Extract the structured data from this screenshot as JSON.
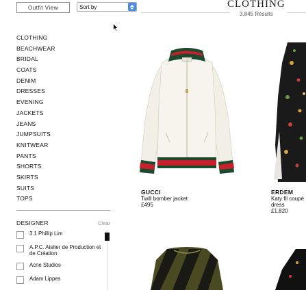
{
  "toolbar": {
    "outfit_view_label": "Outfit View",
    "sort_label": "Sort by"
  },
  "header": {
    "title": "CLOTHING",
    "results": "3,845 Results"
  },
  "sidebar": {
    "categories": [
      "CLOTHING",
      "BEACHWEAR",
      "BRIDAL",
      "COATS",
      "DENIM",
      "DRESSES",
      "EVENING",
      "JACKETS",
      "JEANS",
      "JUMPSUITS",
      "KNITWEAR",
      "PANTS",
      "SHORTS",
      "SKIRTS",
      "SUITS",
      "TOPS"
    ],
    "designer_title": "DESIGNER",
    "clear_label": "Clear",
    "designers": [
      "3.1 Phillip Lim",
      "A.P.C. Atelier de Production et de Création",
      "Acne Studios",
      "Adam Lippes"
    ]
  },
  "products": [
    {
      "brand": "GUCCI",
      "name": "Twill bomber jacket",
      "price": "£495"
    },
    {
      "brand": "ERDEM",
      "name": "Katy fil coupé dress",
      "price": "£1,820"
    }
  ],
  "colors": {
    "accent": "#4a8de0",
    "gucci_red": "#c8202a",
    "gucci_green": "#1d4a2e"
  }
}
